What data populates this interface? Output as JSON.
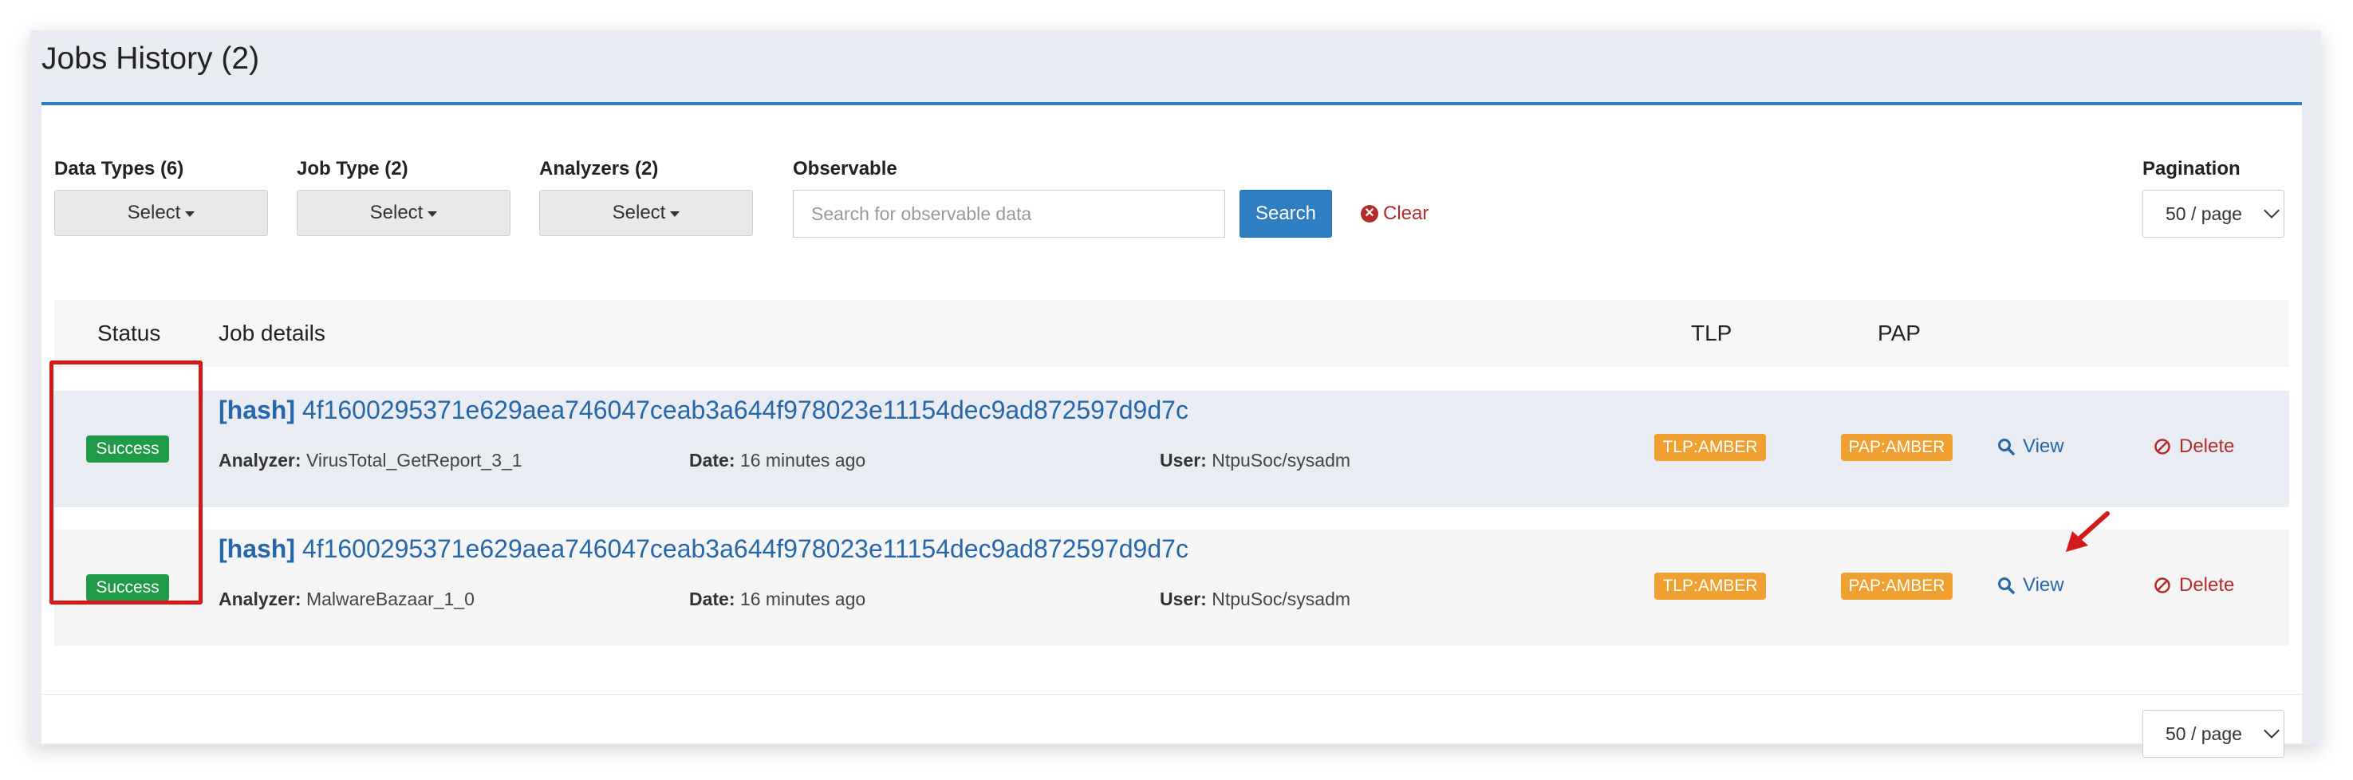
{
  "panel": {
    "title": "Jobs History (2)"
  },
  "filters": {
    "data_types": {
      "label": "Data Types (6)",
      "value": "Select"
    },
    "job_type": {
      "label": "Job Type (2)",
      "value": "Select"
    },
    "analyzers": {
      "label": "Analyzers (2)",
      "value": "Select"
    },
    "observable": {
      "label": "Observable",
      "placeholder": "Search for observable data"
    },
    "search_label": "Search",
    "clear_label": "Clear",
    "pagination": {
      "label": "Pagination",
      "value": "50 / page"
    }
  },
  "table": {
    "headers": {
      "status": "Status",
      "job_details": "Job details",
      "tlp": "TLP",
      "pap": "PAP"
    },
    "rows": [
      {
        "status": "Success",
        "tag": "[hash]",
        "observable": "4f1600295371e629aea746047ceab3a644f978023e11154dec9ad872597d9d7c",
        "analyzer_label": "Analyzer:",
        "analyzer": "VirusTotal_GetReport_3_1",
        "date_label": "Date:",
        "date": "16 minutes ago",
        "user_label": "User:",
        "user": "NtpuSoc/sysadm",
        "tlp": "TLP:AMBER",
        "pap": "PAP:AMBER",
        "view_label": "View",
        "delete_label": "Delete"
      },
      {
        "status": "Success",
        "tag": "[hash]",
        "observable": "4f1600295371e629aea746047ceab3a644f978023e11154dec9ad872597d9d7c",
        "analyzer_label": "Analyzer:",
        "analyzer": "MalwareBazaar_1_0",
        "date_label": "Date:",
        "date": "16 minutes ago",
        "user_label": "User:",
        "user": "NtpuSoc/sysadm",
        "tlp": "TLP:AMBER",
        "pap": "PAP:AMBER",
        "view_label": "View",
        "delete_label": "Delete"
      }
    ]
  },
  "footer": {
    "pagination_value": "50 / page"
  },
  "colors": {
    "accent": "#2f7ec1",
    "success": "#1f9a46",
    "amber": "#f0a030",
    "danger": "#b52b2b",
    "annotation": "#d11a1a"
  }
}
